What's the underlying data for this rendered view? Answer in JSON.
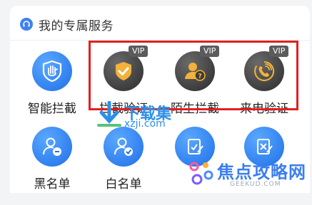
{
  "header": {
    "title": "我的专属服务",
    "icon": "headset-icon"
  },
  "services_row1": [
    {
      "label": "智能拦截",
      "icon": "shield-hand-icon",
      "vip": ""
    },
    {
      "label": "拦截验证",
      "icon": "shield-check-icon",
      "vip": "VIP"
    },
    {
      "label": "陌生拦截",
      "icon": "unknown-person-icon",
      "vip": "VIP"
    },
    {
      "label": "来电验证",
      "icon": "phone-ring-icon",
      "vip": "VIP"
    }
  ],
  "services_row2": [
    {
      "label": "黑名单",
      "icon": "person-minus-icon"
    },
    {
      "label": "白名单",
      "icon": "person-check-icon"
    },
    {
      "label": "",
      "icon": "edit-note-icon"
    },
    {
      "label": "",
      "icon": "edit-note-icon"
    }
  ],
  "watermarks": {
    "w1_text": "下载集",
    "w1_url": "xzji.com",
    "w2_text": "焦点攻略网",
    "w2_url": "GEEKUD.COM"
  },
  "colors": {
    "accent": "#1f6fe8",
    "vip_bg": "#5b5b5b",
    "highlight": "#e02020"
  }
}
